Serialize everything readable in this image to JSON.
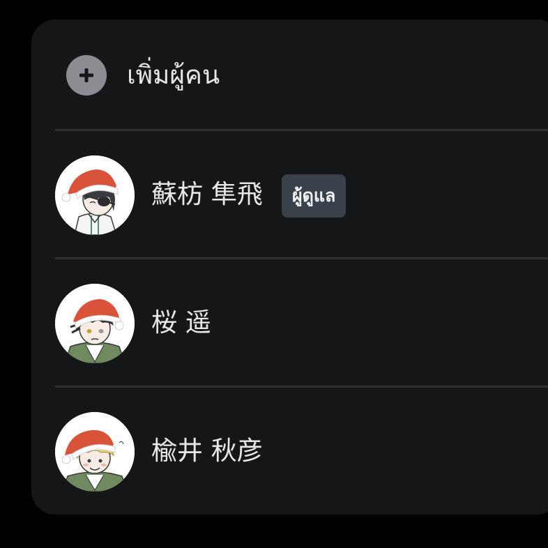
{
  "add_people": {
    "label": "เพิ่มผู้คน",
    "icon": "plus-icon"
  },
  "members": [
    {
      "name": "蘇枋 隼飛",
      "badge": "ผู้ดูแล",
      "avatar": "avatar-santa-hat-eyepatch"
    },
    {
      "name": "桜 遥",
      "avatar": "avatar-santa-hat-dark-hair"
    },
    {
      "name": "楡井 秋彦",
      "avatar": "avatar-santa-hat-blond-hair"
    }
  ],
  "colors": {
    "page_background": "#000000",
    "panel_background": "#151618",
    "divider": "#2e3033",
    "text": "#e6e7e9",
    "add_icon_background": "#8b8d92",
    "badge_background": "#39424b",
    "santa_hat": "#d9533a"
  }
}
